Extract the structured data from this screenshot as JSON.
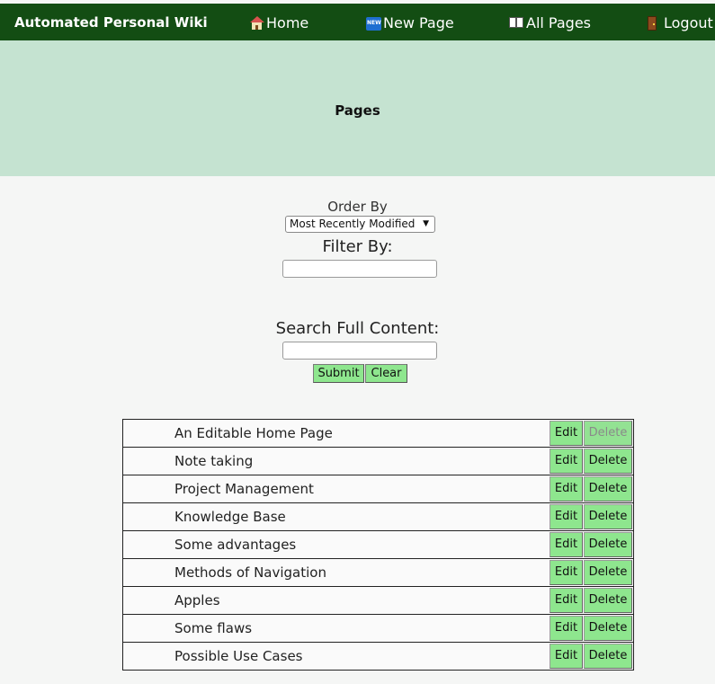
{
  "app": {
    "title": "Automated Personal Wiki"
  },
  "nav": {
    "home": {
      "label": "Home",
      "icon": "home-icon"
    },
    "new_page": {
      "label": "New Page",
      "icon": "new-icon"
    },
    "all_pages": {
      "label": "All Pages",
      "icon": "book-icon"
    },
    "logout": {
      "label": "Logout",
      "icon": "door-icon"
    }
  },
  "banner": {
    "title": "Pages"
  },
  "controls": {
    "order_label": "Order By",
    "order_value": "Most Recently Modified",
    "filter_label": "Filter By:",
    "filter_value": "",
    "search_label": "Search Full Content:",
    "search_value": "",
    "submit_label": "Submit",
    "clear_label": "Clear"
  },
  "pages": [
    {
      "name": "An Editable Home Page",
      "edit": "Edit",
      "delete": "Delete",
      "delete_disabled": true
    },
    {
      "name": "Note taking",
      "edit": "Edit",
      "delete": "Delete",
      "delete_disabled": false
    },
    {
      "name": "Project Management",
      "edit": "Edit",
      "delete": "Delete",
      "delete_disabled": false
    },
    {
      "name": "Knowledge Base",
      "edit": "Edit",
      "delete": "Delete",
      "delete_disabled": false
    },
    {
      "name": "Some advantages",
      "edit": "Edit",
      "delete": "Delete",
      "delete_disabled": false
    },
    {
      "name": "Methods of Navigation",
      "edit": "Edit",
      "delete": "Delete",
      "delete_disabled": false
    },
    {
      "name": "Apples",
      "edit": "Edit",
      "delete": "Delete",
      "delete_disabled": false
    },
    {
      "name": "Some flaws",
      "edit": "Edit",
      "delete": "Delete",
      "delete_disabled": false
    },
    {
      "name": "Possible Use Cases",
      "edit": "Edit",
      "delete": "Delete",
      "delete_disabled": false
    }
  ],
  "colors": {
    "topbar": "#134d13",
    "banner": "#c5e3d1",
    "button": "#8ee68e"
  }
}
